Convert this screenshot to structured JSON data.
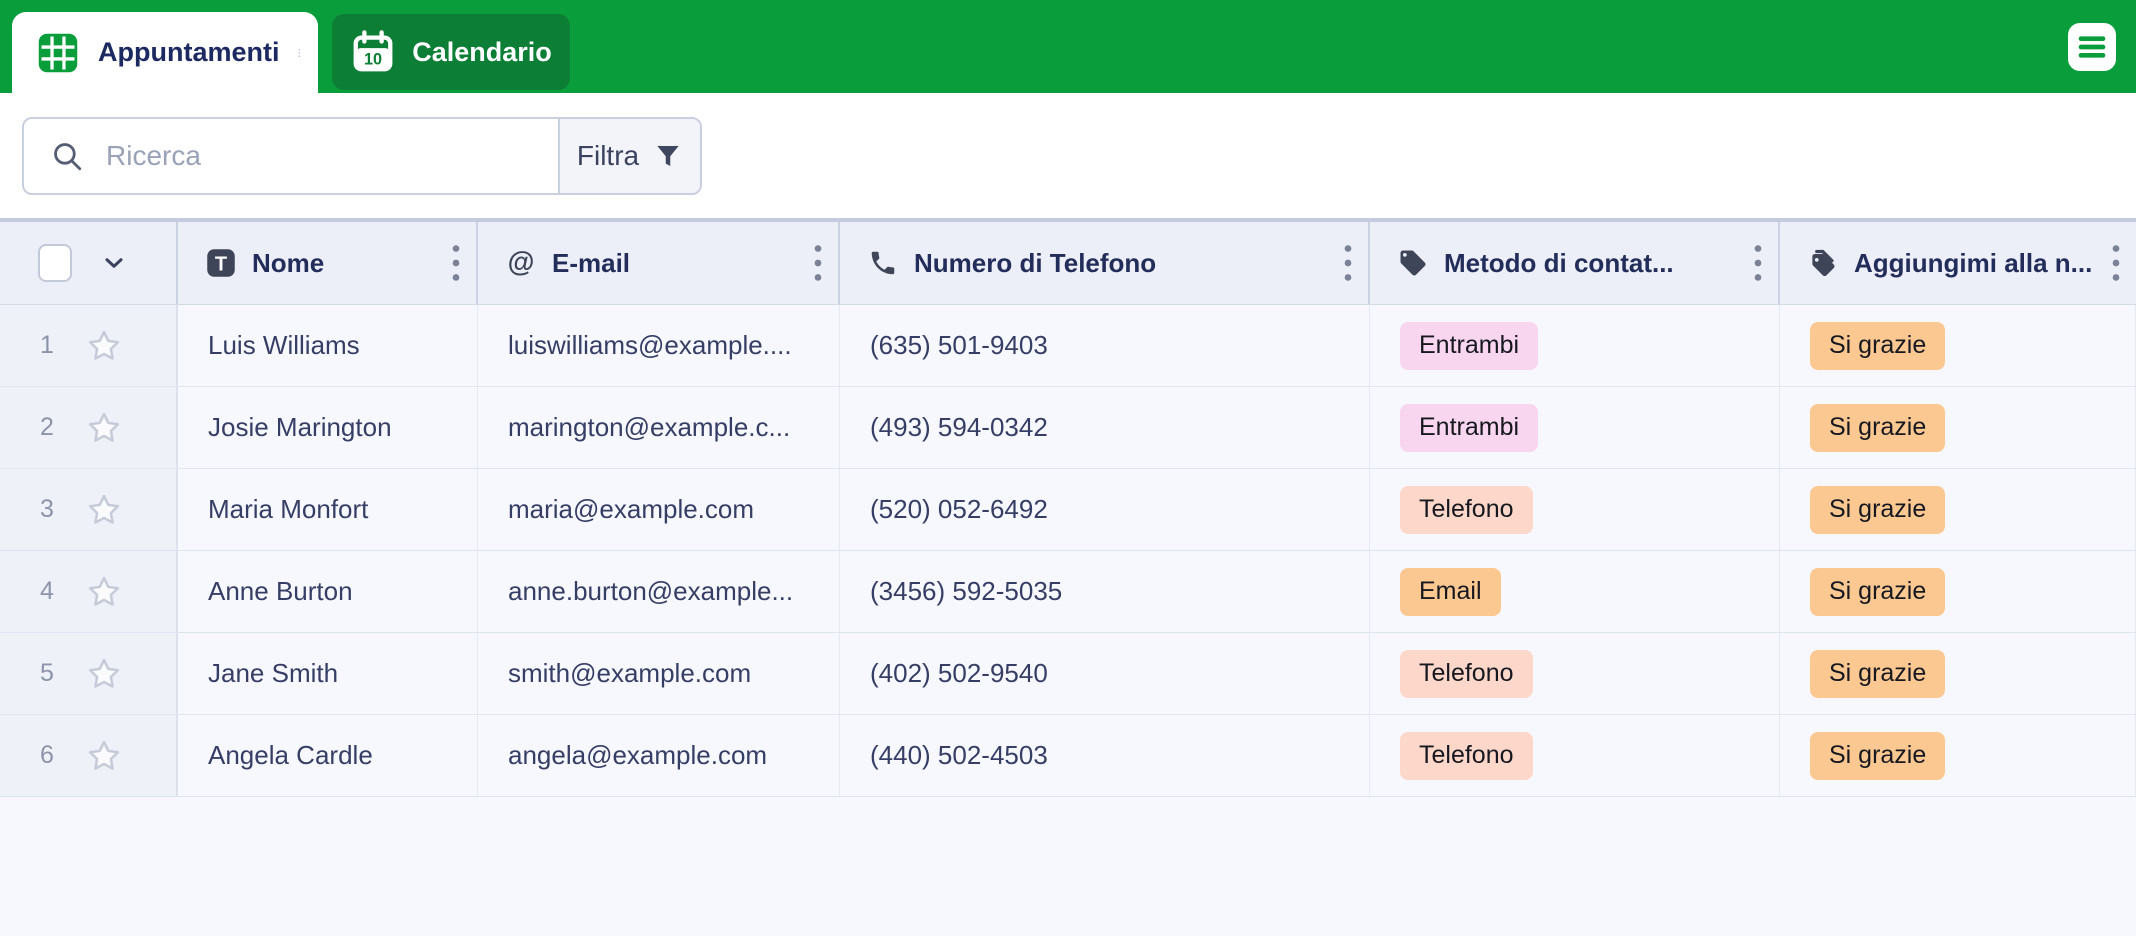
{
  "app": {
    "header_color": "#0a9d3b",
    "inactive_tab_color": "#0c7e35",
    "tabs": [
      {
        "label": "Appuntamenti",
        "icon": "table-grid-icon",
        "active": true
      },
      {
        "label": "Calendario",
        "icon": "calendar-icon",
        "active": false
      }
    ],
    "calendar_icon_day": "10"
  },
  "toolbar": {
    "search_placeholder": "Ricerca",
    "filter_label": "Filtra"
  },
  "table": {
    "columns": [
      {
        "label": "Nome",
        "icon": "text-icon"
      },
      {
        "label": "E-mail",
        "icon": "at-icon"
      },
      {
        "label": "Numero di Telefono",
        "icon": "phone-icon"
      },
      {
        "label": "Metodo di contat...",
        "icon": "tag-icon"
      },
      {
        "label": "Aggiungimi alla n...",
        "icon": "tags-icon"
      }
    ],
    "badge_palette": {
      "pink": "#f9d6ef",
      "salmon": "#fdd8ca",
      "orange": "#fbc891"
    },
    "rows": [
      {
        "num": "1",
        "nome": "Luis Williams",
        "email": "luiswilliams@example....",
        "telefono": "(635) 501-9403",
        "metodo": {
          "label": "Entrambi",
          "color": "#f9d6ef"
        },
        "aggiungimi": {
          "label": "Si grazie",
          "color": "#fbc891"
        }
      },
      {
        "num": "2",
        "nome": "Josie Marington",
        "email": "marington@example.c...",
        "telefono": "(493) 594-0342",
        "metodo": {
          "label": "Entrambi",
          "color": "#f9d6ef"
        },
        "aggiungimi": {
          "label": "Si grazie",
          "color": "#fbc891"
        }
      },
      {
        "num": "3",
        "nome": "Maria Monfort",
        "email": "maria@example.com",
        "telefono": "(520) 052-6492",
        "metodo": {
          "label": "Telefono",
          "color": "#fdd8ca"
        },
        "aggiungimi": {
          "label": "Si grazie",
          "color": "#fbc891"
        }
      },
      {
        "num": "4",
        "nome": "Anne Burton",
        "email": "anne.burton@example...",
        "telefono": "(3456) 592-5035",
        "metodo": {
          "label": "Email",
          "color": "#fbc891"
        },
        "aggiungimi": {
          "label": "Si grazie",
          "color": "#fbc891"
        }
      },
      {
        "num": "5",
        "nome": "Jane Smith",
        "email": "smith@example.com",
        "telefono": "(402) 502-9540",
        "metodo": {
          "label": "Telefono",
          "color": "#fdd8ca"
        },
        "aggiungimi": {
          "label": "Si grazie",
          "color": "#fbc891"
        }
      },
      {
        "num": "6",
        "nome": "Angela Cardle",
        "email": "angela@example.com",
        "telefono": "(440) 502-4503",
        "metodo": {
          "label": "Telefono",
          "color": "#fdd8ca"
        },
        "aggiungimi": {
          "label": "Si grazie",
          "color": "#fbc891"
        }
      }
    ]
  }
}
